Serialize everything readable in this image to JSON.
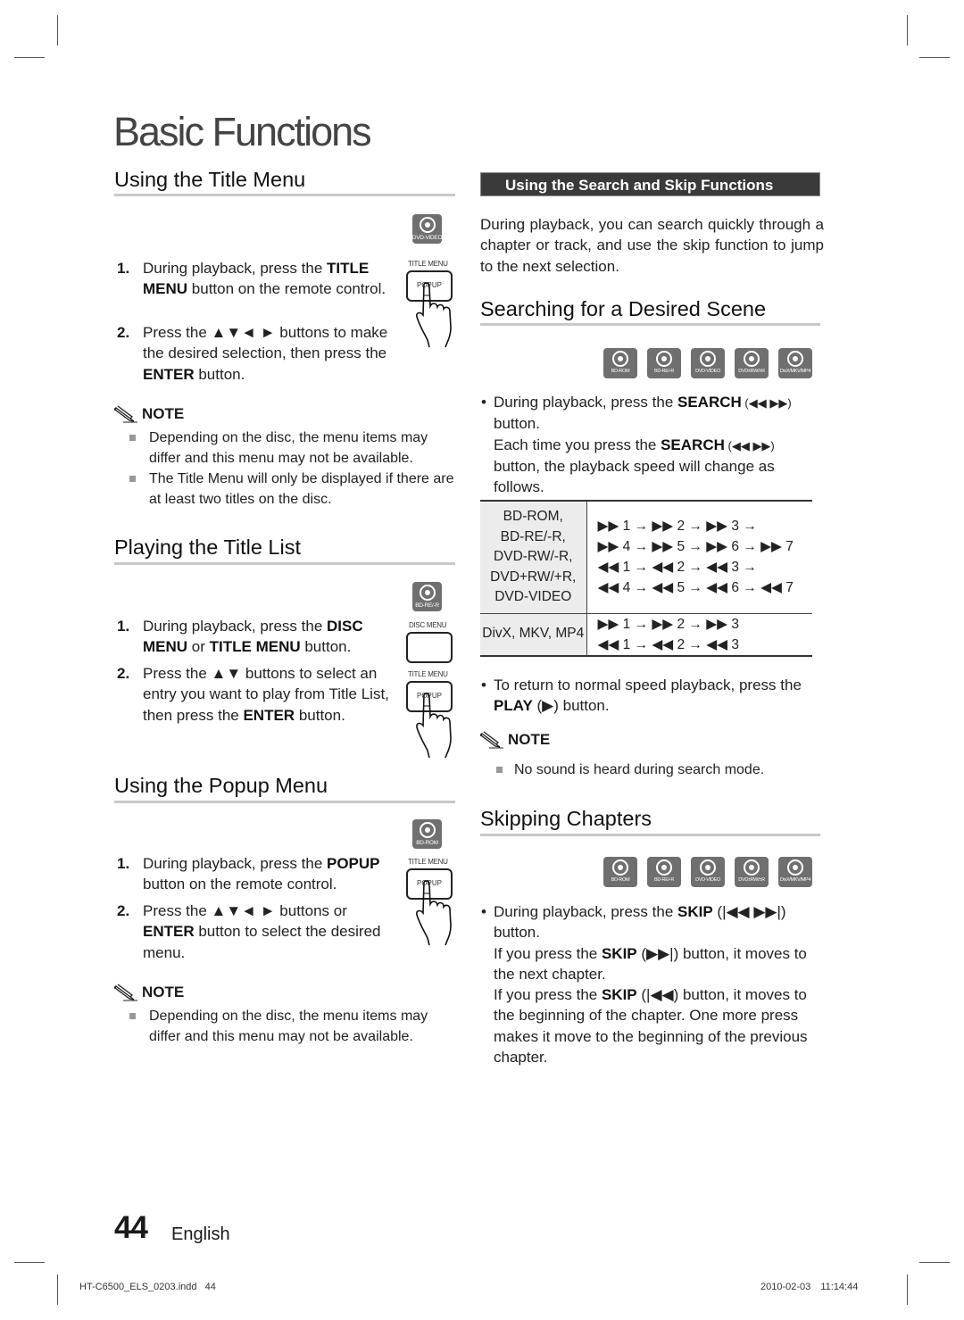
{
  "page_title": "Basic Functions",
  "left": {
    "title_menu": {
      "heading": "Using the Title Menu",
      "disc_badge": "DVD-VIDEO",
      "remote_label": "TITLE MENU",
      "remote_button": "POPUP",
      "steps": [
        {
          "num": "1.",
          "pre": "During playback, press the ",
          "bold": "TITLE MENU",
          "post": " button on the remote control."
        },
        {
          "num": "2.",
          "pre": "Press the ▲▼◄ ► buttons to make the desired selection, then press the ",
          "bold": "ENTER",
          "post": " button."
        }
      ],
      "note_label": "NOTE",
      "notes": [
        "Depending on the disc, the menu items may differ and this menu may not be available.",
        "The Title Menu will only be displayed if there are at least two titles on the disc."
      ]
    },
    "title_list": {
      "heading": "Playing the Title List",
      "disc_badge": "BD-RE/-R",
      "remote_label_1": "DISC MENU",
      "remote_label_2": "TITLE MENU",
      "remote_button": "POPUP",
      "steps": [
        {
          "num": "1.",
          "pre": "During playback, press the ",
          "bold": "DISC MENU",
          "mid": " or ",
          "bold2": "TITLE MENU",
          "post": " button."
        },
        {
          "num": "2.",
          "pre": "Press the ▲▼ buttons to select an entry you want to play from Title List, then press the ",
          "bold": "ENTER",
          "post": " button."
        }
      ]
    },
    "popup_menu": {
      "heading": "Using the Popup Menu",
      "disc_badge": "BD-ROM",
      "remote_label": "TITLE MENU",
      "remote_button": "POPUP",
      "steps": [
        {
          "num": "1.",
          "pre": "During playback, press the ",
          "bold": "POPUP",
          "post": " button on the remote control."
        },
        {
          "num": "2.",
          "pre": "Press the ▲▼◄ ► buttons or ",
          "bold": "ENTER",
          "post": " button to select the desired menu."
        }
      ],
      "note_label": "NOTE",
      "notes": [
        "Depending on the disc, the menu items may differ and this menu may not be available."
      ]
    }
  },
  "right": {
    "banner": "Using the Search and Skip Functions",
    "intro": "During playback, you can search quickly through a chapter or track, and use the skip function to jump to the next selection.",
    "search": {
      "heading": "Searching for a Desired Scene",
      "disc_badges": [
        "BD-ROM",
        "BD-RE/-R",
        "DVD-VIDEO",
        "DVD±RW/±R",
        "DivX/MKV/MP4"
      ],
      "bullet1_pre": "During playback, press the ",
      "bullet1_bold": "SEARCH",
      "bullet1_sym": " (◀◀ ▶▶)",
      "bullet1_post": " button.",
      "bullet1_sub_pre": "Each time you press the ",
      "bullet1_sub_bold": "SEARCH",
      "bullet1_sub_sym": " (◀◀ ▶▶)",
      "bullet1_sub_post": " button, the playback speed will change as follows.",
      "table": [
        {
          "media": [
            "BD-ROM,",
            "BD-RE/-R,",
            "DVD-RW/-R,",
            "DVD+RW/+R,",
            "DVD-VIDEO"
          ],
          "sequence": [
            "▶▶ 1 → ▶▶ 2 → ▶▶ 3 →",
            "▶▶ 4 → ▶▶ 5 → ▶▶ 6 → ▶▶ 7",
            "◀◀ 1 → ◀◀ 2 → ◀◀ 3 →",
            "◀◀ 4 → ◀◀ 5 → ◀◀ 6 → ◀◀ 7"
          ]
        },
        {
          "media": [
            "DivX, MKV, MP4"
          ],
          "sequence": [
            "▶▶ 1 → ▶▶ 2 → ▶▶ 3",
            "◀◀ 1 → ◀◀ 2 → ◀◀ 3"
          ]
        }
      ],
      "bullet2_pre": "To return to normal speed playback, press the ",
      "bullet2_bold": "PLAY",
      "bullet2_post": " (▶) button.",
      "note_label": "NOTE",
      "notes": [
        "No sound is heard during search mode."
      ]
    },
    "skip": {
      "heading": "Skipping Chapters",
      "disc_badges": [
        "BD-ROM",
        "BD-RE/-R",
        "DVD-VIDEO",
        "DVD±RW/±R",
        "DivX/MKV/MP4"
      ],
      "b1_pre": "During playback, press the ",
      "b1_bold": "SKIP",
      "b1_post": " (|◀◀ ▶▶|) button.",
      "b2_pre": "If you press the ",
      "b2_bold": "SKIP",
      "b2_post": " (▶▶|) button, it moves to the next chapter.",
      "b3_pre": "If you press the ",
      "b3_bold": "SKIP",
      "b3_post": " (|◀◀) button, it moves to the beginning of the chapter. One more press makes it move to the beginning of the previous chapter."
    }
  },
  "footer": {
    "page_number": "44",
    "language": "English",
    "file": "HT-C6500_ELS_0203.indd   44",
    "date": "2010-02-03",
    "time": "11:14:44"
  }
}
